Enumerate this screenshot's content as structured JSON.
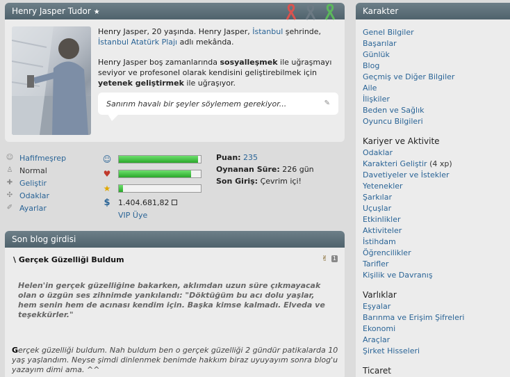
{
  "profile": {
    "name": "Henry Jasper Tudor",
    "bio_line1_prefix": "Henry Jasper, 20 yaşında. Henry Jasper,",
    "bio_city": "İstanbul",
    "bio_line1_mid": "şehrinde,",
    "bio_place": "İstanbul Atatürk Plajı",
    "bio_line1_suffix": "adlı mekânda.",
    "bio_p2_a": "Henry Jasper boş zamanlarında",
    "bio_p2_b": "sosyalleşmek",
    "bio_p2_c": "ile uğraşmayı seviyor ve profesoneI olarak kendisini geliştirebilmek için",
    "bio_p2_d": "yetenek geliştirmek",
    "bio_p2_e": "ile uğraşıyor.",
    "quote": "Sanırım havalı bir şeyler söylemem gerekiyor...",
    "ribbon_colors": [
      "#d9534f",
      "#6c7a84",
      "#5cb85c"
    ]
  },
  "actions": [
    {
      "icon": "smiley-icon",
      "label": "Hafifmeşrep",
      "link": true
    },
    {
      "icon": "person-icon",
      "label": "Normal",
      "link": false
    },
    {
      "icon": "plus-icon",
      "label": "Geliştir",
      "link": true
    },
    {
      "icon": "compass-icon",
      "label": "Odaklar",
      "link": true
    },
    {
      "icon": "wrench-icon",
      "label": "Ayarlar",
      "link": true
    }
  ],
  "stats": {
    "mood_level": 0.97,
    "health_level": 0.88,
    "star_level": 0.05,
    "money": "1.404.681,82",
    "vip": "VIP Üye"
  },
  "info": {
    "score_label": "Puan:",
    "score_value": "235",
    "played_label": "Oynanan Süre:",
    "played_value": "226 gün",
    "login_label": "Son Giriş:",
    "login_value": "Çevrim içi!"
  },
  "blog": {
    "header": "Son blog girdisi",
    "title": "\\ Gerçek Güzelliği Buldum",
    "count": "1",
    "quote": "Helen'in gerçek güzelliğine bakarken, aklımdan uzun süre çıkmayacak olan o üzgün ses zihnimde yankılandı: \"Döktüğüm bu acı dolu yaşlar, hem senin hem de acınası kendim için. Başka kimse kalmadı. Elveda ve teşekkürler.\"",
    "body_first": "G",
    "body_rest": "erçek güzelliği buldum. Nah buldum ben o gerçek güzelliği 2 gündür patikalarda 10 yaş yaşlandım. Neyse şimdi dinlenmek benimde hakkım biraz uyuyayım sonra blog'u yazayım dimi ama. ^^"
  },
  "sidebar": {
    "header": "Karakter",
    "karakter_items": [
      "Genel Bilgiler",
      "Başarılar",
      "Günlük",
      "Blog",
      "Geçmiş ve Diğer Bilgiler",
      "Aile",
      "İlişkiler",
      "Beden ve Sağlık",
      "Oyuncu Bilgileri"
    ],
    "kariyer_header": "Kariyer ve Aktivite",
    "kariyer_items": [
      "Odaklar",
      "Karakteri Geliştir",
      "Davetiyeler ve İstekler",
      "Yetenekler",
      "Şarkılar",
      "Uçuşlar",
      "Etkinlikler",
      "Aktiviteler",
      "İstihdam",
      "Öğrencilikler",
      "Tarifler",
      "Kişilik ve Davranış"
    ],
    "gelistir_suffix": "(4 xp)",
    "varliklar_header": "Varlıklar",
    "varliklar_items": [
      "Eşyalar",
      "Barınma ve Erişim Şifreleri",
      "Ekonomi",
      "Araçlar",
      "Şirket Hisseleri"
    ],
    "ticaret_header": "Ticaret"
  }
}
